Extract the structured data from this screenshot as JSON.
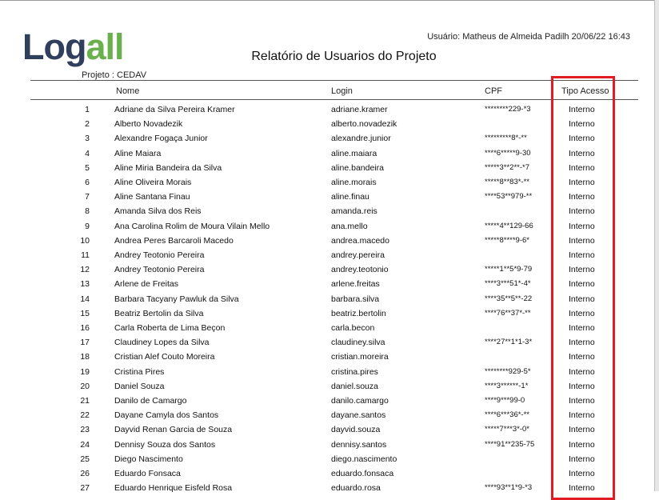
{
  "logo": {
    "part1": "Lo",
    "part2": "g",
    "part3": "all"
  },
  "header": {
    "user_line": "Usuário: Matheus de Almeida Padilh 20/06/22 16:43",
    "title": "Relatório de Usuarios do Projeto",
    "project": "Projeto : CEDAV"
  },
  "columns": {
    "nome": "Nome",
    "login": "Login",
    "cpf": "CPF",
    "tipo": "Tipo Acesso"
  },
  "highlight_color": "#e31b23",
  "rows": [
    {
      "num": "1",
      "nome": "Adriane da Silva Pereira Kramer",
      "login": "adriane.kramer",
      "cpf": "********229-*3",
      "tipo": "Interno"
    },
    {
      "num": "2",
      "nome": "Alberto Novadezik",
      "login": "alberto.novadezik",
      "cpf": "",
      "tipo": "Interno"
    },
    {
      "num": "3",
      "nome": "Alexandre Fogaça Junior",
      "login": "alexandre.junior",
      "cpf": "*********8*-**",
      "tipo": "Interno"
    },
    {
      "num": "4",
      "nome": "Aline Maiara",
      "login": "aline.maiara",
      "cpf": "****6*****9-30",
      "tipo": "Interno"
    },
    {
      "num": "5",
      "nome": "Aline Miria Bandeira da Silva",
      "login": "aline.bandeira",
      "cpf": "*****3**2**-*7",
      "tipo": "Interno"
    },
    {
      "num": "6",
      "nome": "Aline Oliveira Morais",
      "login": "aline.morais",
      "cpf": "*****8**83*-**",
      "tipo": "Interno"
    },
    {
      "num": "7",
      "nome": "Aline Santana Finau",
      "login": "aline.finau",
      "cpf": "****53**979-**",
      "tipo": "Interno"
    },
    {
      "num": "8",
      "nome": "Amanda Silva dos Reis",
      "login": "amanda.reis",
      "cpf": "",
      "tipo": "Interno"
    },
    {
      "num": "9",
      "nome": "Ana Carolina Rolim de Moura Vilain Mello",
      "login": "ana.mello",
      "cpf": "*****4**129-66",
      "tipo": "Interno"
    },
    {
      "num": "10",
      "nome": "Andrea Peres  Barcaroli Macedo",
      "login": "andrea.macedo",
      "cpf": "*****8****9-6*",
      "tipo": "Interno"
    },
    {
      "num": "11",
      "nome": "Andrey Teotonio Pereira",
      "login": "andrey.pereira",
      "cpf": "",
      "tipo": "Interno"
    },
    {
      "num": "12",
      "nome": "Andrey Teotonio Pereira",
      "login": "andrey.teotonio",
      "cpf": "*****1**5*9-79",
      "tipo": "Interno"
    },
    {
      "num": "13",
      "nome": "Arlene de Freitas",
      "login": "arlene.freitas",
      "cpf": "****3***51*-4*",
      "tipo": "Interno"
    },
    {
      "num": "14",
      "nome": "Barbara Tacyany Pawluk da Silva",
      "login": "barbara.silva",
      "cpf": "****35**5**-22",
      "tipo": "Interno"
    },
    {
      "num": "15",
      "nome": "Beatriz Bertolin da Silva",
      "login": "beatriz.bertolin",
      "cpf": "****76**37*-**",
      "tipo": "Interno"
    },
    {
      "num": "16",
      "nome": "Carla Roberta  de Lima Beçon",
      "login": "carla.becon",
      "cpf": "",
      "tipo": "Interno"
    },
    {
      "num": "17",
      "nome": "Claudiney Lopes da Silva",
      "login": "claudiney.silva",
      "cpf": "****27**1*1-3*",
      "tipo": "Interno"
    },
    {
      "num": "18",
      "nome": "Cristian Alef Couto Moreira",
      "login": "cristian.moreira",
      "cpf": "",
      "tipo": "Interno"
    },
    {
      "num": "19",
      "nome": "Cristina Pires",
      "login": "cristina.pires",
      "cpf": "********929-5*",
      "tipo": "Interno"
    },
    {
      "num": "20",
      "nome": "Daniel Souza",
      "login": "daniel.souza",
      "cpf": "****3******-1*",
      "tipo": "Interno"
    },
    {
      "num": "21",
      "nome": "Danilo de Camargo",
      "login": "danilo.camargo",
      "cpf": "****9***99-0",
      "tipo": "Interno"
    },
    {
      "num": "22",
      "nome": "Dayane Camyla dos Santos",
      "login": "dayane.santos",
      "cpf": "****6***36*-**",
      "tipo": "Interno"
    },
    {
      "num": "23",
      "nome": "Dayvid Renan Garcia de Souza",
      "login": "dayvid.souza",
      "cpf": "*****7***3*-0*",
      "tipo": "Interno"
    },
    {
      "num": "24",
      "nome": "Dennisy Souza dos Santos",
      "login": "dennisy.santos",
      "cpf": "****91**235-75",
      "tipo": "Interno"
    },
    {
      "num": "25",
      "nome": "Diego Nascimento",
      "login": "diego.nascimento",
      "cpf": "",
      "tipo": "Interno"
    },
    {
      "num": "26",
      "nome": "Eduardo Fonsaca",
      "login": "eduardo.fonsaca",
      "cpf": "",
      "tipo": "Interno"
    },
    {
      "num": "27",
      "nome": "Eduardo Henrique Eisfeld Rosa",
      "login": "eduardo.rosa",
      "cpf": "****93**1*9-*3",
      "tipo": "Interno"
    }
  ]
}
